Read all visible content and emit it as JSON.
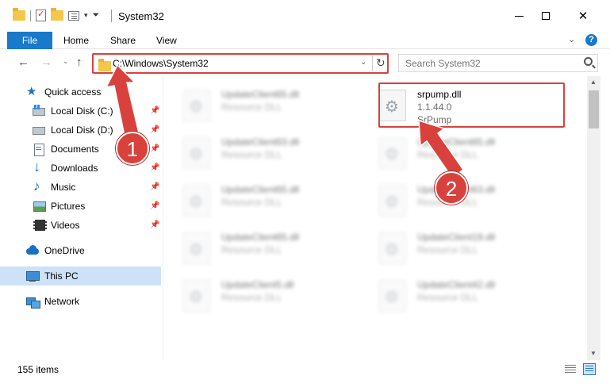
{
  "window": {
    "title": "System32",
    "colors": {
      "accent": "#1979ca",
      "highlight": "#d9423c",
      "selection": "#cde2f7"
    }
  },
  "ribbon": {
    "file": "File",
    "home": "Home",
    "share": "Share",
    "view": "View",
    "help": "?"
  },
  "address": {
    "path": "C:\\Windows\\System32",
    "search_placeholder": "Search System32"
  },
  "nav": {
    "items": [
      {
        "label": "Quick access",
        "icon": "star-icon"
      },
      {
        "label": "Local Disk (C:)",
        "icon": "disk-icon"
      },
      {
        "label": "Local Disk (D:)",
        "icon": "disk-icon"
      },
      {
        "label": "Documents",
        "icon": "documents-icon"
      },
      {
        "label": "Downloads",
        "icon": "downloads-icon"
      },
      {
        "label": "Music",
        "icon": "music-icon"
      },
      {
        "label": "Pictures",
        "icon": "pictures-icon"
      },
      {
        "label": "Videos",
        "icon": "videos-icon"
      },
      {
        "label": "OneDrive",
        "icon": "onedrive-icon"
      },
      {
        "label": "This PC",
        "icon": "pc-icon",
        "selected": true
      },
      {
        "label": "Network",
        "icon": "network-icon"
      }
    ]
  },
  "files": {
    "left": [
      {
        "name": "UpdateClient65.dll",
        "desc": "Resource DLL"
      },
      {
        "name": "UpdateClient63.dll",
        "desc": "Resource DLL"
      },
      {
        "name": "UpdateClient65.dll",
        "desc": "Resource DLL"
      },
      {
        "name": "UpdateClient65.dll",
        "desc": "Resource DLL"
      },
      {
        "name": "UpdateClient5.dll",
        "desc": "Resource DLL"
      }
    ],
    "right": [
      {
        "name": "srpump.dll",
        "desc": "1.1.44.0",
        "desc2": "SrPump"
      },
      {
        "name": "UpdateClient65.dll",
        "desc": "Resource DLL"
      },
      {
        "name": "UpdateClient63.dll",
        "desc": "Resource DLL"
      },
      {
        "name": "UpdateClient19.dll",
        "desc": "Resource DLL"
      },
      {
        "name": "UpdateClient42.dll",
        "desc": "Resource DLL"
      }
    ]
  },
  "status": {
    "count": "155 items"
  },
  "annotations": {
    "step1": "1",
    "step2": "2"
  }
}
